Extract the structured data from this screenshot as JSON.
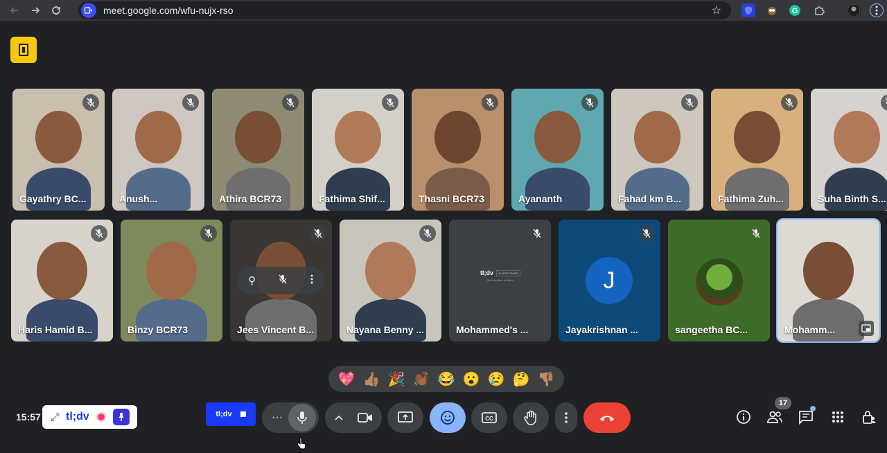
{
  "browser": {
    "url": "meet.google.com/wfu-nujx-rso"
  },
  "participants_row1": [
    {
      "name": "Gayathry BC...",
      "bg": "#c9bfae"
    },
    {
      "name": "Anush...",
      "bg": "#cfc7c2"
    },
    {
      "name": "Athira BCR73",
      "bg": "#8f8a73"
    },
    {
      "name": "Fathima Shif...",
      "bg": "#d2d0c8"
    },
    {
      "name": "Thasni BCR73",
      "bg": "#b98f6c"
    },
    {
      "name": "Ayananth",
      "bg": "#5fa8b0"
    },
    {
      "name": "Fahad km B...",
      "bg": "#cdc7bd"
    },
    {
      "name": "Fathima Zuh...",
      "bg": "#d8b07e"
    },
    {
      "name": "Suha Binth S...",
      "bg": "#d6d2d0"
    }
  ],
  "participants_row2": [
    {
      "name": "Haris Hamid B...",
      "bg": "#d8d4cc"
    },
    {
      "name": "Binzy BCR73",
      "bg": "#7f8a5c"
    },
    {
      "name": "Jees Vincent B...",
      "bg": "#3a3633"
    },
    {
      "name": "Nayana Benny ...",
      "bg": "#c8c6bc"
    },
    {
      "name": "Mohammed's ...",
      "bg": "#3c4043"
    },
    {
      "name": "Jayakrishnan ...",
      "bg": "#0d4a7a"
    },
    {
      "name": "sangeetha BC...",
      "bg": "#3f6b28"
    },
    {
      "name": "Mohamm...",
      "bg": "#dcdad3"
    }
  ],
  "jayakrishnan_initial": "J",
  "tldv_notetaker": {
    "title": "tl;dv",
    "badge": "AI NOTETAKER",
    "subtitle": "Get it for free at tldv.io"
  },
  "reactions": [
    "💖",
    "👍🏽",
    "🎉",
    "👏🏾",
    "😂",
    "😮",
    "😢",
    "🤔",
    "👎🏽"
  ],
  "bottom": {
    "time": "15:57",
    "tldv_label": "tl;dv",
    "tldv_stop_label": "tl;dv",
    "more_label": "···",
    "people_count": "17"
  },
  "colors": {
    "accent": "#8ab4f8",
    "leave": "#ea4335",
    "tldv_blue": "#1a3af5",
    "door_yellow": "#f9c80e"
  }
}
